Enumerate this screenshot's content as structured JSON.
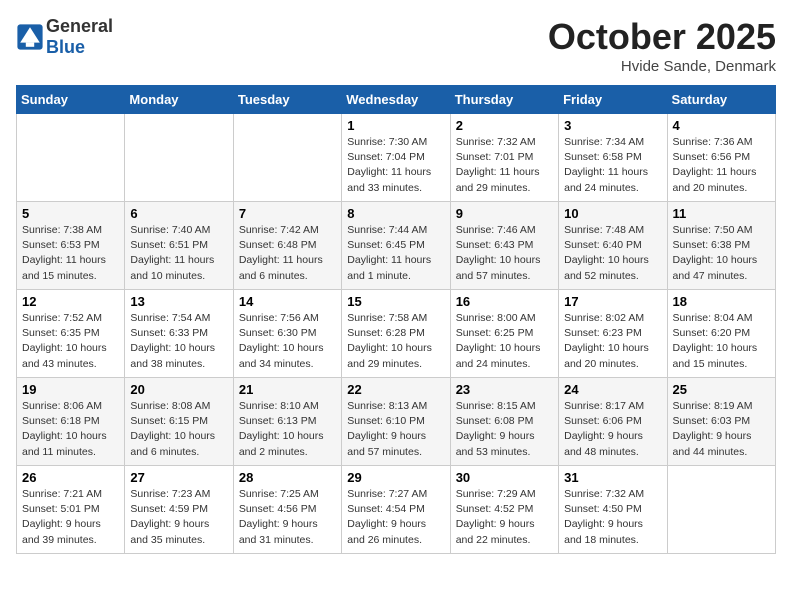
{
  "header": {
    "logo_general": "General",
    "logo_blue": "Blue",
    "title": "October 2025",
    "subtitle": "Hvide Sande, Denmark"
  },
  "weekdays": [
    "Sunday",
    "Monday",
    "Tuesday",
    "Wednesday",
    "Thursday",
    "Friday",
    "Saturday"
  ],
  "weeks": [
    [
      {
        "day": "",
        "info": ""
      },
      {
        "day": "",
        "info": ""
      },
      {
        "day": "",
        "info": ""
      },
      {
        "day": "1",
        "info": "Sunrise: 7:30 AM\nSunset: 7:04 PM\nDaylight: 11 hours\nand 33 minutes."
      },
      {
        "day": "2",
        "info": "Sunrise: 7:32 AM\nSunset: 7:01 PM\nDaylight: 11 hours\nand 29 minutes."
      },
      {
        "day": "3",
        "info": "Sunrise: 7:34 AM\nSunset: 6:58 PM\nDaylight: 11 hours\nand 24 minutes."
      },
      {
        "day": "4",
        "info": "Sunrise: 7:36 AM\nSunset: 6:56 PM\nDaylight: 11 hours\nand 20 minutes."
      }
    ],
    [
      {
        "day": "5",
        "info": "Sunrise: 7:38 AM\nSunset: 6:53 PM\nDaylight: 11 hours\nand 15 minutes."
      },
      {
        "day": "6",
        "info": "Sunrise: 7:40 AM\nSunset: 6:51 PM\nDaylight: 11 hours\nand 10 minutes."
      },
      {
        "day": "7",
        "info": "Sunrise: 7:42 AM\nSunset: 6:48 PM\nDaylight: 11 hours\nand 6 minutes."
      },
      {
        "day": "8",
        "info": "Sunrise: 7:44 AM\nSunset: 6:45 PM\nDaylight: 11 hours\nand 1 minute."
      },
      {
        "day": "9",
        "info": "Sunrise: 7:46 AM\nSunset: 6:43 PM\nDaylight: 10 hours\nand 57 minutes."
      },
      {
        "day": "10",
        "info": "Sunrise: 7:48 AM\nSunset: 6:40 PM\nDaylight: 10 hours\nand 52 minutes."
      },
      {
        "day": "11",
        "info": "Sunrise: 7:50 AM\nSunset: 6:38 PM\nDaylight: 10 hours\nand 47 minutes."
      }
    ],
    [
      {
        "day": "12",
        "info": "Sunrise: 7:52 AM\nSunset: 6:35 PM\nDaylight: 10 hours\nand 43 minutes."
      },
      {
        "day": "13",
        "info": "Sunrise: 7:54 AM\nSunset: 6:33 PM\nDaylight: 10 hours\nand 38 minutes."
      },
      {
        "day": "14",
        "info": "Sunrise: 7:56 AM\nSunset: 6:30 PM\nDaylight: 10 hours\nand 34 minutes."
      },
      {
        "day": "15",
        "info": "Sunrise: 7:58 AM\nSunset: 6:28 PM\nDaylight: 10 hours\nand 29 minutes."
      },
      {
        "day": "16",
        "info": "Sunrise: 8:00 AM\nSunset: 6:25 PM\nDaylight: 10 hours\nand 24 minutes."
      },
      {
        "day": "17",
        "info": "Sunrise: 8:02 AM\nSunset: 6:23 PM\nDaylight: 10 hours\nand 20 minutes."
      },
      {
        "day": "18",
        "info": "Sunrise: 8:04 AM\nSunset: 6:20 PM\nDaylight: 10 hours\nand 15 minutes."
      }
    ],
    [
      {
        "day": "19",
        "info": "Sunrise: 8:06 AM\nSunset: 6:18 PM\nDaylight: 10 hours\nand 11 minutes."
      },
      {
        "day": "20",
        "info": "Sunrise: 8:08 AM\nSunset: 6:15 PM\nDaylight: 10 hours\nand 6 minutes."
      },
      {
        "day": "21",
        "info": "Sunrise: 8:10 AM\nSunset: 6:13 PM\nDaylight: 10 hours\nand 2 minutes."
      },
      {
        "day": "22",
        "info": "Sunrise: 8:13 AM\nSunset: 6:10 PM\nDaylight: 9 hours\nand 57 minutes."
      },
      {
        "day": "23",
        "info": "Sunrise: 8:15 AM\nSunset: 6:08 PM\nDaylight: 9 hours\nand 53 minutes."
      },
      {
        "day": "24",
        "info": "Sunrise: 8:17 AM\nSunset: 6:06 PM\nDaylight: 9 hours\nand 48 minutes."
      },
      {
        "day": "25",
        "info": "Sunrise: 8:19 AM\nSunset: 6:03 PM\nDaylight: 9 hours\nand 44 minutes."
      }
    ],
    [
      {
        "day": "26",
        "info": "Sunrise: 7:21 AM\nSunset: 5:01 PM\nDaylight: 9 hours\nand 39 minutes."
      },
      {
        "day": "27",
        "info": "Sunrise: 7:23 AM\nSunset: 4:59 PM\nDaylight: 9 hours\nand 35 minutes."
      },
      {
        "day": "28",
        "info": "Sunrise: 7:25 AM\nSunset: 4:56 PM\nDaylight: 9 hours\nand 31 minutes."
      },
      {
        "day": "29",
        "info": "Sunrise: 7:27 AM\nSunset: 4:54 PM\nDaylight: 9 hours\nand 26 minutes."
      },
      {
        "day": "30",
        "info": "Sunrise: 7:29 AM\nSunset: 4:52 PM\nDaylight: 9 hours\nand 22 minutes."
      },
      {
        "day": "31",
        "info": "Sunrise: 7:32 AM\nSunset: 4:50 PM\nDaylight: 9 hours\nand 18 minutes."
      },
      {
        "day": "",
        "info": ""
      }
    ]
  ]
}
